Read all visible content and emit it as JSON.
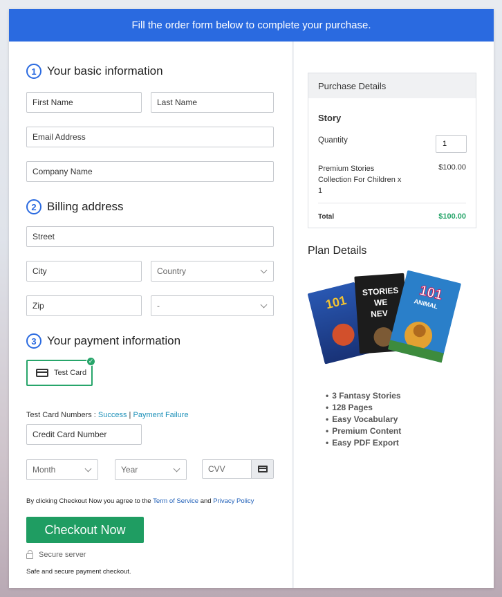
{
  "banner": "Fill the order form below to complete your purchase.",
  "sections": {
    "basic": {
      "num": "1",
      "title": "Your basic information"
    },
    "billing": {
      "num": "2",
      "title": "Billing address"
    },
    "payment": {
      "num": "3",
      "title": "Your payment information"
    }
  },
  "fields": {
    "first_name": "First Name",
    "last_name": "Last Name",
    "email": "Email Address",
    "company": "Company Name",
    "street": "Street",
    "city": "City",
    "country": "Country",
    "zip": "Zip",
    "state": "-",
    "card_number": "Credit Card Number",
    "month": "Month",
    "year": "Year",
    "cvv": "CVV"
  },
  "payment": {
    "method": "Test Card",
    "test_numbers_label": "Test Card Numbers : ",
    "success": "Success",
    "separator": " | ",
    "failure": "Payment Failure"
  },
  "agree": {
    "prefix": "By clicking Checkout Now you agree to the ",
    "terms": "Term of Service",
    "and": " and ",
    "privacy": "Privacy Policy"
  },
  "checkout_label": "Checkout Now",
  "secure_label": "Secure server",
  "safe_label": "Safe and secure payment checkout.",
  "purchase": {
    "header": "Purchase Details",
    "product": "Story",
    "quantity_label": "Quantity",
    "quantity": "1",
    "item_line1": "Premium Stories",
    "item_line2": "Collection For Children x",
    "item_line3": "1",
    "item_price": "$100.00",
    "total_label": "Total",
    "total_value": "$100.00"
  },
  "plan": {
    "title": "Plan Details",
    "features": [
      "3 Fantasy Stories",
      "128 Pages",
      "Easy Vocabulary",
      "Premium Content",
      "Easy PDF Export"
    ],
    "cover_texts": [
      "101",
      "STORIES",
      "WE",
      "NEV",
      "101",
      "ANIMAL"
    ]
  },
  "colors": {
    "accent": "#2a6ae0",
    "checkout": "#1f9d62",
    "total": "#27a56a",
    "link": "#1a8fb8"
  }
}
